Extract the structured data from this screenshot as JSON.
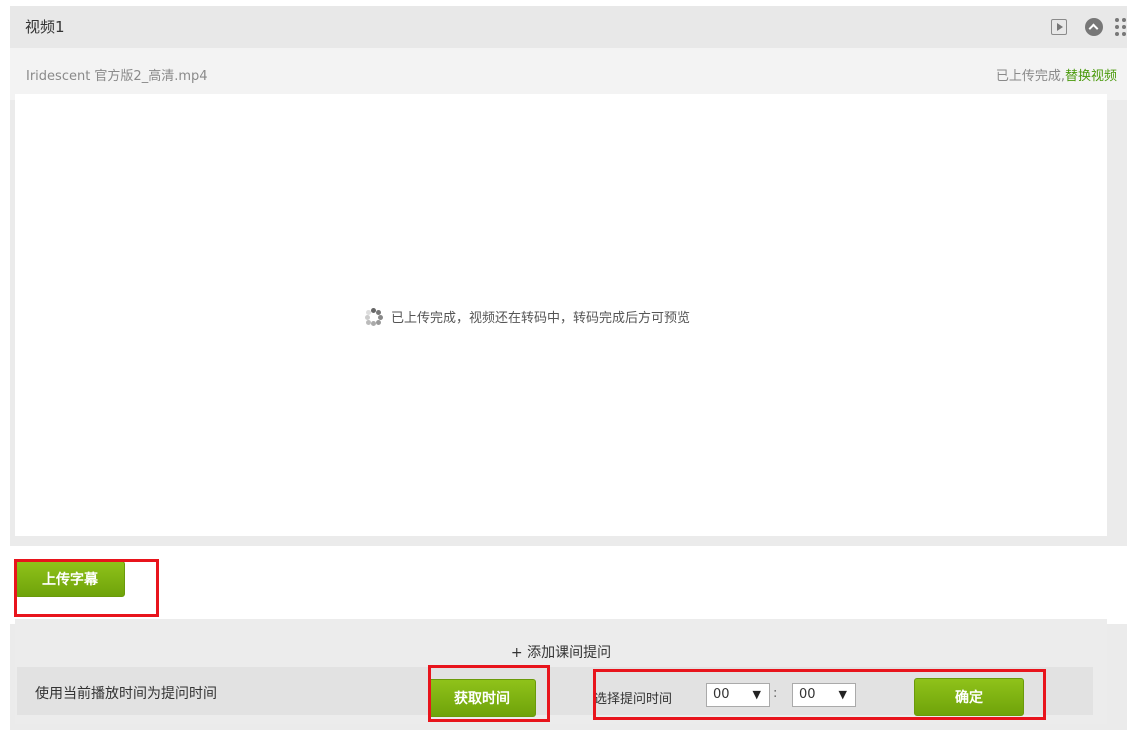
{
  "header": {
    "title": "视频1",
    "icons": [
      "play-icon",
      "collapse-icon",
      "drag-handle-icon"
    ]
  },
  "file": {
    "name": "Iridescent 官方版2_高清.mp4",
    "status_text": "已上传完成,",
    "replace_link": "替换视频"
  },
  "preview": {
    "icon": "loading-spinner-icon",
    "message": "已上传完成，视频还在转码中，转码完成后方可预览"
  },
  "upload_subtitle_label": "上传字幕",
  "question": {
    "add_label": "+ 添加课间提问",
    "use_current_time_label": "使用当前播放时间为提问时间",
    "get_time_label": "获取时间",
    "select_time_label": "选择提问时间",
    "minutes_value": "00",
    "seconds_value": "00",
    "separator": ":",
    "confirm_label": "确定"
  },
  "colors": {
    "accent_green": "#7ab314",
    "link_green": "#4a9a0c",
    "highlight_red": "#e8141c"
  }
}
